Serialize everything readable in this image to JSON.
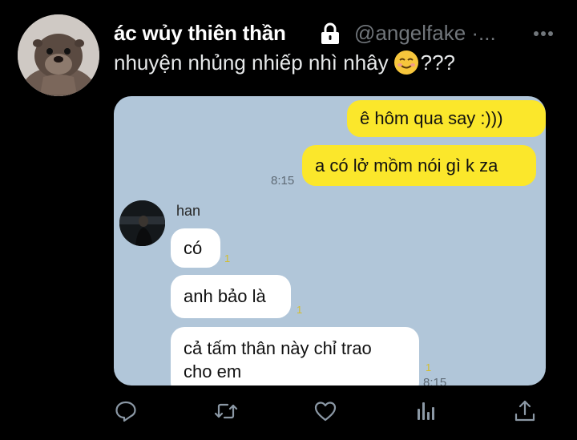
{
  "tweet": {
    "display_name": "ác wủy thiên thần",
    "handle": "@angelfake ·...",
    "text": "nhuyện nhủng nhiếp nhì nhây",
    "text_suffix": "???",
    "emoji": "smiling-face-icon"
  },
  "chat": {
    "messages_me": [
      {
        "text": "ê hôm qua say :)))"
      },
      {
        "text": "a có lở mồm nói gì k za",
        "time": "8:15"
      }
    ],
    "sender_name": "han",
    "messages_them": [
      {
        "text": "có",
        "read": "1"
      },
      {
        "text": "anh bảo là",
        "read": "1"
      },
      {
        "line1": "cả tấm thân này chỉ trao",
        "line2": "cho em",
        "read": "1",
        "time": "8:15"
      }
    ]
  },
  "colors": {
    "background": "#000000",
    "chat_background": "#b1c6d9",
    "my_bubble": "#fbe72b",
    "their_bubble": "#ffffff",
    "secondary_text": "#71767b"
  },
  "actions": [
    "reply-icon",
    "retweet-icon",
    "like-icon",
    "views-icon",
    "share-icon"
  ]
}
